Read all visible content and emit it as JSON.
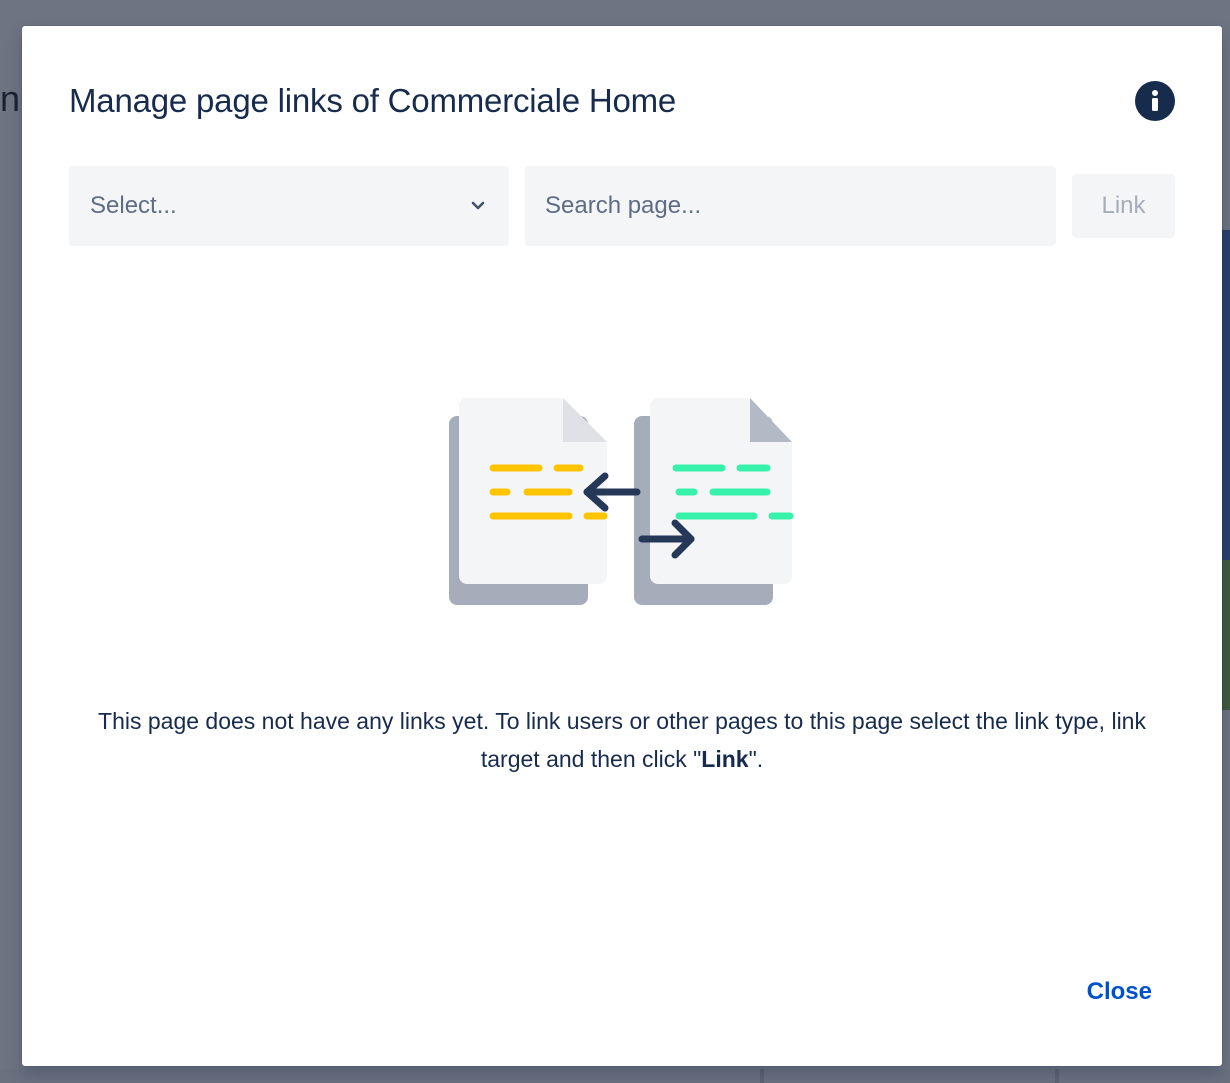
{
  "background": {
    "title_fragment": "n"
  },
  "modal": {
    "title": "Manage page links of Commerciale Home",
    "info_icon": "info-icon",
    "select": {
      "value": "Select...",
      "icon": "chevron-down-icon"
    },
    "search": {
      "placeholder": "Search page..."
    },
    "link_button": "Link",
    "illustration_icon": "linked-pages-icon",
    "empty_message": {
      "line1": "This page does not have any links yet. To link users or other pages to this page select the link type, link target and then click \"",
      "bold": "Link",
      "line2": "\"."
    },
    "close_button": "Close"
  },
  "colors": {
    "title": "#172b4d",
    "accent": "#0052cc",
    "field_bg": "#f4f5f7",
    "disabled_text": "#a5adba",
    "yellow_lines": "#ffc400",
    "green_lines": "#36f1aa",
    "arrows": "#253858"
  }
}
